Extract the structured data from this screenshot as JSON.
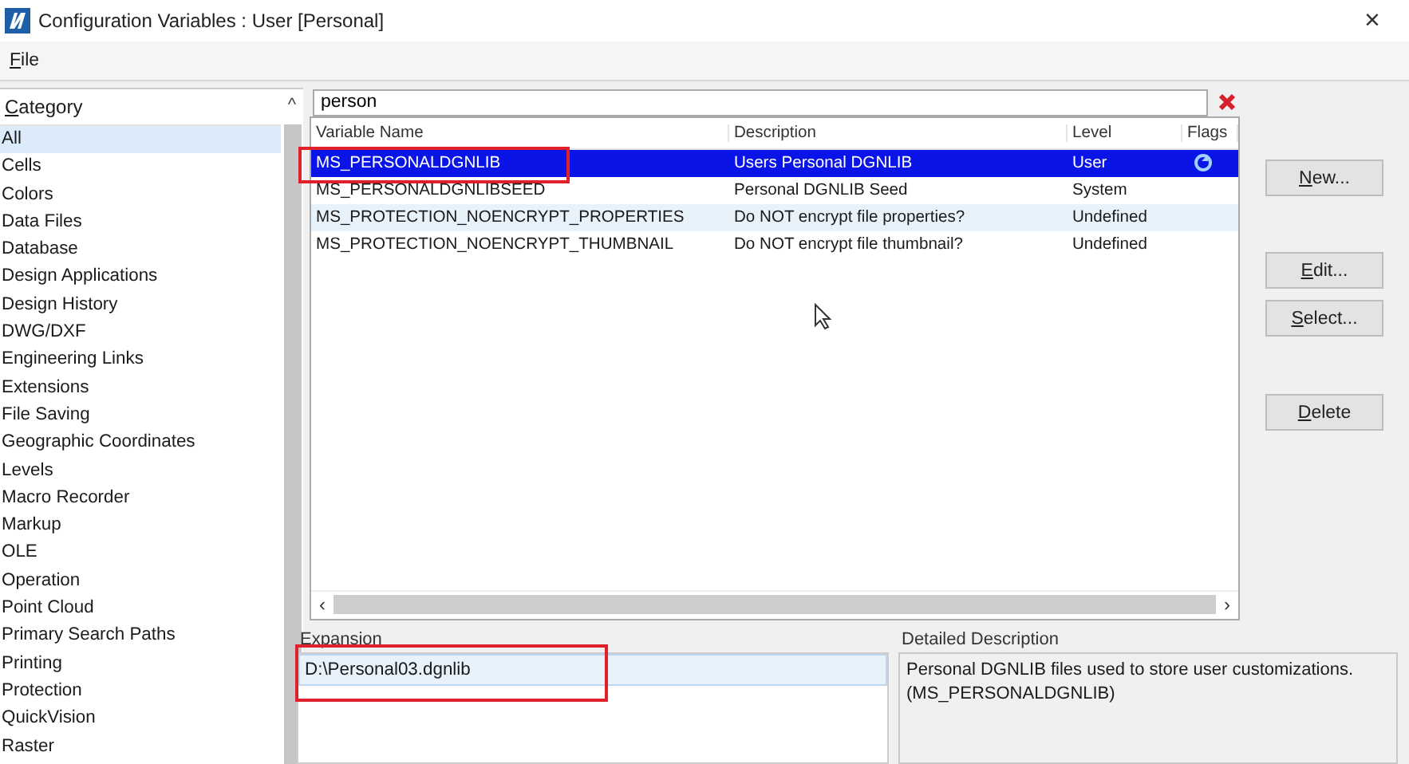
{
  "window": {
    "title": "Configuration Variables : User [Personal]",
    "close": "×"
  },
  "menu": [
    {
      "key": "F",
      "rest": "ile"
    }
  ],
  "category": {
    "header_key": "C",
    "header_rest": "ategory",
    "scroll_up": "^",
    "items": [
      {
        "label": "All",
        "selected": true
      },
      {
        "label": "Cells",
        "selected": false
      },
      {
        "label": "Colors",
        "selected": false
      },
      {
        "label": "Data Files",
        "selected": false
      },
      {
        "label": "Database",
        "selected": false
      },
      {
        "label": "Design Applications",
        "selected": false
      },
      {
        "label": "Design History",
        "selected": false
      },
      {
        "label": "DWG/DXF",
        "selected": false
      },
      {
        "label": "Engineering Links",
        "selected": false
      },
      {
        "label": "Extensions",
        "selected": false
      },
      {
        "label": "File Saving",
        "selected": false
      },
      {
        "label": "Geographic Coordinates",
        "selected": false
      },
      {
        "label": "Levels",
        "selected": false
      },
      {
        "label": "Macro Recorder",
        "selected": false
      },
      {
        "label": "Markup",
        "selected": false
      },
      {
        "label": "OLE",
        "selected": false
      },
      {
        "label": "Operation",
        "selected": false
      },
      {
        "label": "Point Cloud",
        "selected": false
      },
      {
        "label": "Primary Search Paths",
        "selected": false
      },
      {
        "label": "Printing",
        "selected": false
      },
      {
        "label": "Protection",
        "selected": false
      },
      {
        "label": "QuickVision",
        "selected": false
      },
      {
        "label": "Raster",
        "selected": false
      }
    ]
  },
  "search": {
    "value": "person"
  },
  "table": {
    "columns": [
      "Variable Name",
      "Description",
      "Level",
      "Flags"
    ],
    "rows": [
      {
        "name": "MS_PERSONALDGNLIB",
        "description": "Users Personal DGNLIB",
        "level": "User",
        "sync_flag": true,
        "selected": true,
        "hovered": false,
        "highlighted": true
      },
      {
        "name": "MS_PERSONALDGNLIBSEED",
        "description": "Personal DGNLIB Seed",
        "level": "System",
        "sync_flag": false,
        "selected": false,
        "hovered": false,
        "highlighted": false
      },
      {
        "name": "MS_PROTECTION_NOENCRYPT_PROPERTIES",
        "description": "Do NOT encrypt file properties?",
        "level": "Undefined",
        "sync_flag": false,
        "selected": false,
        "hovered": true,
        "highlighted": false
      },
      {
        "name": "MS_PROTECTION_NOENCRYPT_THUMBNAIL",
        "description": "Do NOT encrypt file thumbnail?",
        "level": "Undefined",
        "sync_flag": false,
        "selected": false,
        "hovered": false,
        "highlighted": false
      }
    ],
    "scroll_left": "‹",
    "scroll_right": "›"
  },
  "buttons": [
    {
      "key": "N",
      "rest": "ew..."
    },
    {
      "key": "E",
      "rest": "dit..."
    },
    {
      "key": "S",
      "rest": "elect..."
    },
    {
      "key": "D",
      "rest": "elete"
    }
  ],
  "expansion": {
    "label": "Expansion",
    "value": "D:\\Personal03.dgnlib",
    "highlighted": true
  },
  "detailed_description": {
    "label": "Detailed Description",
    "lines": [
      "Personal DGNLIB files used to store user customizations.",
      "(MS_PERSONALDGNLIB)"
    ]
  }
}
